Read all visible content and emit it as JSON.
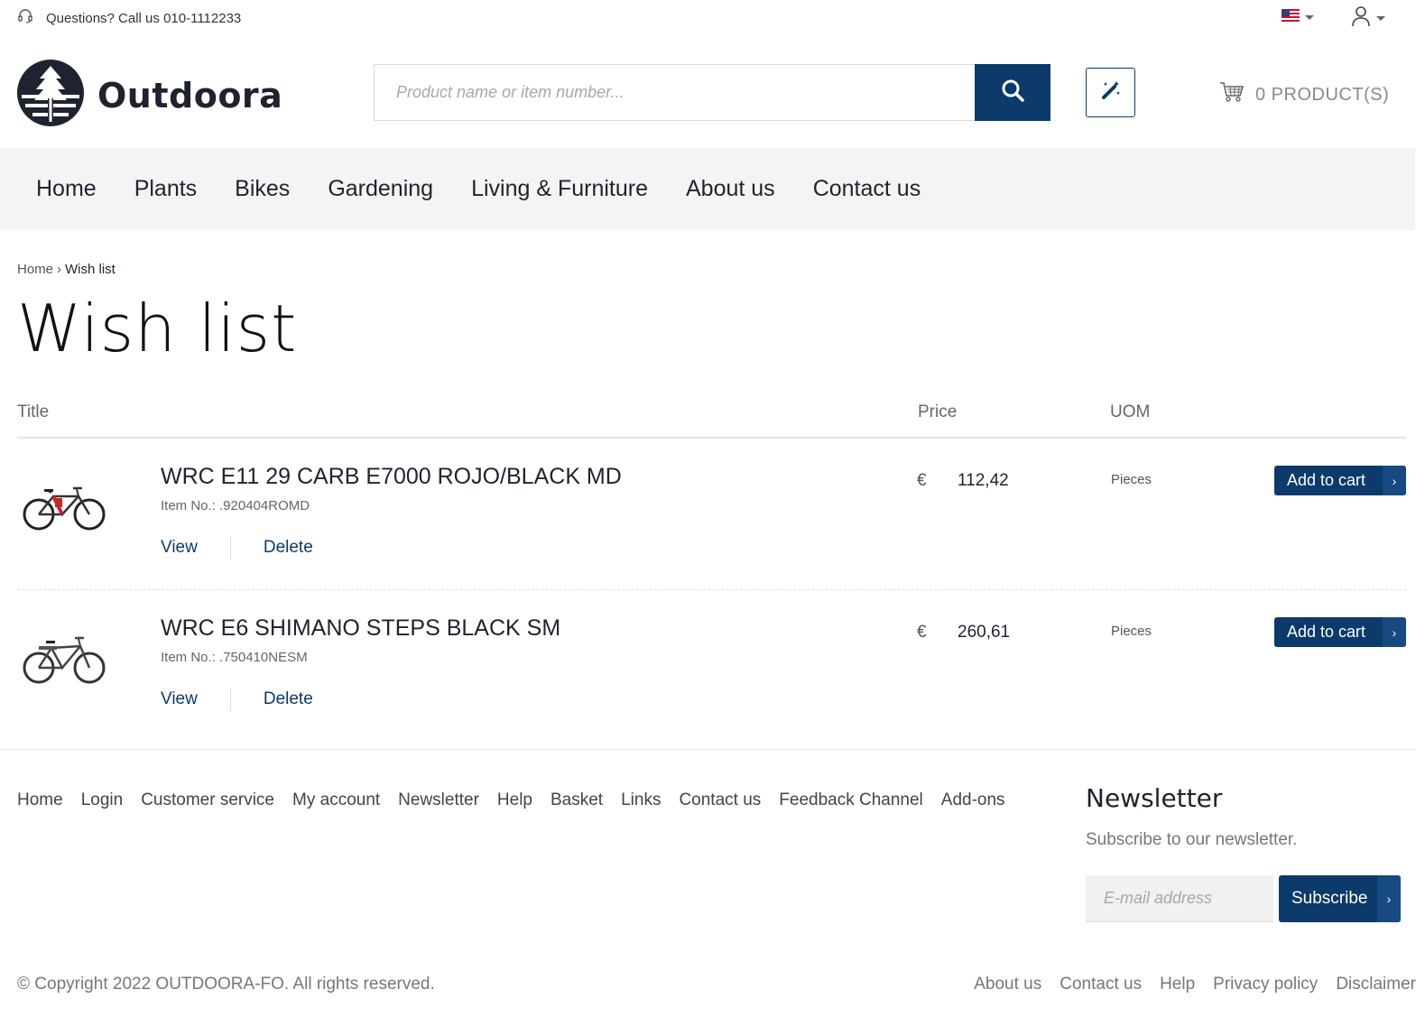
{
  "topbar": {
    "phone_text": "Questions? Call us 010-1112233",
    "headset_icon": "headset-icon",
    "flag_icon": "us-flag-icon",
    "user_icon": "user-icon"
  },
  "header": {
    "logo_text": "Outdoora",
    "search_placeholder": "Product name or item number...",
    "search_icon": "search-icon",
    "wand_icon": "magic-wand-icon",
    "cart_text": "0 PRODUCT(S)",
    "cart_icon": "cart-icon"
  },
  "nav": {
    "items": [
      "Home",
      "Plants",
      "Bikes",
      "Gardening",
      "Living & Furniture",
      "About us",
      "Contact us"
    ]
  },
  "breadcrumb": {
    "home": "Home",
    "separator": "›",
    "current": "Wish list"
  },
  "page": {
    "title": "Wish list"
  },
  "table": {
    "headers": {
      "title": "Title",
      "price": "Price",
      "uom": "UOM"
    },
    "rows": [
      {
        "title": "WRC E11 29 CARB E7000 ROJO/BLACK MD",
        "item_no": "Item No.: .920404ROMD",
        "view": "View",
        "delete": "Delete",
        "currency": "€",
        "price": "112,42",
        "uom": "Pieces",
        "add_to_cart": "Add to cart"
      },
      {
        "title": "WRC E6 SHIMANO STEPS BLACK SM",
        "item_no": "Item No.: .750410NESM",
        "view": "View",
        "delete": "Delete",
        "currency": "€",
        "price": "260,61",
        "uom": "Pieces",
        "add_to_cart": "Add to cart"
      }
    ]
  },
  "footer": {
    "links": [
      "Home",
      "Login",
      "Customer service",
      "My account",
      "Newsletter",
      "Help",
      "Basket",
      "Links",
      "Contact us",
      "Feedback Channel",
      "Add-ons"
    ],
    "newsletter_title": "Newsletter",
    "newsletter_sub": "Subscribe to our newsletter.",
    "email_placeholder": "E-mail address",
    "subscribe_label": "Subscribe",
    "copyright": "© Copyright 2022 OUTDOORA-FO. All rights reserved.",
    "bottom_links": [
      "About us",
      "Contact us",
      "Help",
      "Privacy policy",
      "Disclaimer"
    ]
  },
  "colors": {
    "primary": "#0c3a6b",
    "text": "#1f2330",
    "nav_bg": "#f4f4f4"
  }
}
